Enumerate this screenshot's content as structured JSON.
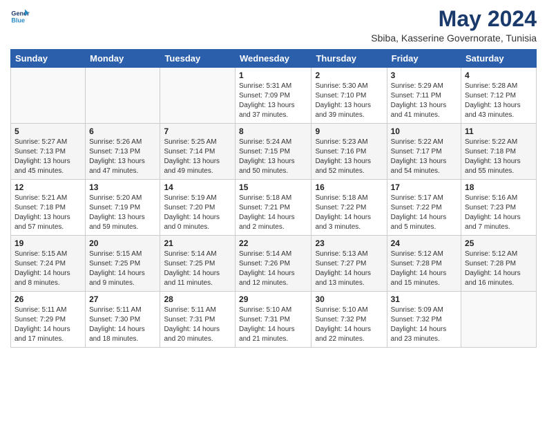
{
  "header": {
    "logo_line1": "General",
    "logo_line2": "Blue",
    "month_year": "May 2024",
    "location": "Sbiba, Kasserine Governorate, Tunisia"
  },
  "weekdays": [
    "Sunday",
    "Monday",
    "Tuesday",
    "Wednesday",
    "Thursday",
    "Friday",
    "Saturday"
  ],
  "weeks": [
    [
      {
        "day": "",
        "info": ""
      },
      {
        "day": "",
        "info": ""
      },
      {
        "day": "",
        "info": ""
      },
      {
        "day": "1",
        "info": "Sunrise: 5:31 AM\nSunset: 7:09 PM\nDaylight: 13 hours\nand 37 minutes."
      },
      {
        "day": "2",
        "info": "Sunrise: 5:30 AM\nSunset: 7:10 PM\nDaylight: 13 hours\nand 39 minutes."
      },
      {
        "day": "3",
        "info": "Sunrise: 5:29 AM\nSunset: 7:11 PM\nDaylight: 13 hours\nand 41 minutes."
      },
      {
        "day": "4",
        "info": "Sunrise: 5:28 AM\nSunset: 7:12 PM\nDaylight: 13 hours\nand 43 minutes."
      }
    ],
    [
      {
        "day": "5",
        "info": "Sunrise: 5:27 AM\nSunset: 7:13 PM\nDaylight: 13 hours\nand 45 minutes."
      },
      {
        "day": "6",
        "info": "Sunrise: 5:26 AM\nSunset: 7:13 PM\nDaylight: 13 hours\nand 47 minutes."
      },
      {
        "day": "7",
        "info": "Sunrise: 5:25 AM\nSunset: 7:14 PM\nDaylight: 13 hours\nand 49 minutes."
      },
      {
        "day": "8",
        "info": "Sunrise: 5:24 AM\nSunset: 7:15 PM\nDaylight: 13 hours\nand 50 minutes."
      },
      {
        "day": "9",
        "info": "Sunrise: 5:23 AM\nSunset: 7:16 PM\nDaylight: 13 hours\nand 52 minutes."
      },
      {
        "day": "10",
        "info": "Sunrise: 5:22 AM\nSunset: 7:17 PM\nDaylight: 13 hours\nand 54 minutes."
      },
      {
        "day": "11",
        "info": "Sunrise: 5:22 AM\nSunset: 7:18 PM\nDaylight: 13 hours\nand 55 minutes."
      }
    ],
    [
      {
        "day": "12",
        "info": "Sunrise: 5:21 AM\nSunset: 7:18 PM\nDaylight: 13 hours\nand 57 minutes."
      },
      {
        "day": "13",
        "info": "Sunrise: 5:20 AM\nSunset: 7:19 PM\nDaylight: 13 hours\nand 59 minutes."
      },
      {
        "day": "14",
        "info": "Sunrise: 5:19 AM\nSunset: 7:20 PM\nDaylight: 14 hours\nand 0 minutes."
      },
      {
        "day": "15",
        "info": "Sunrise: 5:18 AM\nSunset: 7:21 PM\nDaylight: 14 hours\nand 2 minutes."
      },
      {
        "day": "16",
        "info": "Sunrise: 5:18 AM\nSunset: 7:22 PM\nDaylight: 14 hours\nand 3 minutes."
      },
      {
        "day": "17",
        "info": "Sunrise: 5:17 AM\nSunset: 7:22 PM\nDaylight: 14 hours\nand 5 minutes."
      },
      {
        "day": "18",
        "info": "Sunrise: 5:16 AM\nSunset: 7:23 PM\nDaylight: 14 hours\nand 7 minutes."
      }
    ],
    [
      {
        "day": "19",
        "info": "Sunrise: 5:15 AM\nSunset: 7:24 PM\nDaylight: 14 hours\nand 8 minutes."
      },
      {
        "day": "20",
        "info": "Sunrise: 5:15 AM\nSunset: 7:25 PM\nDaylight: 14 hours\nand 9 minutes."
      },
      {
        "day": "21",
        "info": "Sunrise: 5:14 AM\nSunset: 7:25 PM\nDaylight: 14 hours\nand 11 minutes."
      },
      {
        "day": "22",
        "info": "Sunrise: 5:14 AM\nSunset: 7:26 PM\nDaylight: 14 hours\nand 12 minutes."
      },
      {
        "day": "23",
        "info": "Sunrise: 5:13 AM\nSunset: 7:27 PM\nDaylight: 14 hours\nand 13 minutes."
      },
      {
        "day": "24",
        "info": "Sunrise: 5:12 AM\nSunset: 7:28 PM\nDaylight: 14 hours\nand 15 minutes."
      },
      {
        "day": "25",
        "info": "Sunrise: 5:12 AM\nSunset: 7:28 PM\nDaylight: 14 hours\nand 16 minutes."
      }
    ],
    [
      {
        "day": "26",
        "info": "Sunrise: 5:11 AM\nSunset: 7:29 PM\nDaylight: 14 hours\nand 17 minutes."
      },
      {
        "day": "27",
        "info": "Sunrise: 5:11 AM\nSunset: 7:30 PM\nDaylight: 14 hours\nand 18 minutes."
      },
      {
        "day": "28",
        "info": "Sunrise: 5:11 AM\nSunset: 7:31 PM\nDaylight: 14 hours\nand 20 minutes."
      },
      {
        "day": "29",
        "info": "Sunrise: 5:10 AM\nSunset: 7:31 PM\nDaylight: 14 hours\nand 21 minutes."
      },
      {
        "day": "30",
        "info": "Sunrise: 5:10 AM\nSunset: 7:32 PM\nDaylight: 14 hours\nand 22 minutes."
      },
      {
        "day": "31",
        "info": "Sunrise: 5:09 AM\nSunset: 7:32 PM\nDaylight: 14 hours\nand 23 minutes."
      },
      {
        "day": "",
        "info": ""
      }
    ]
  ]
}
